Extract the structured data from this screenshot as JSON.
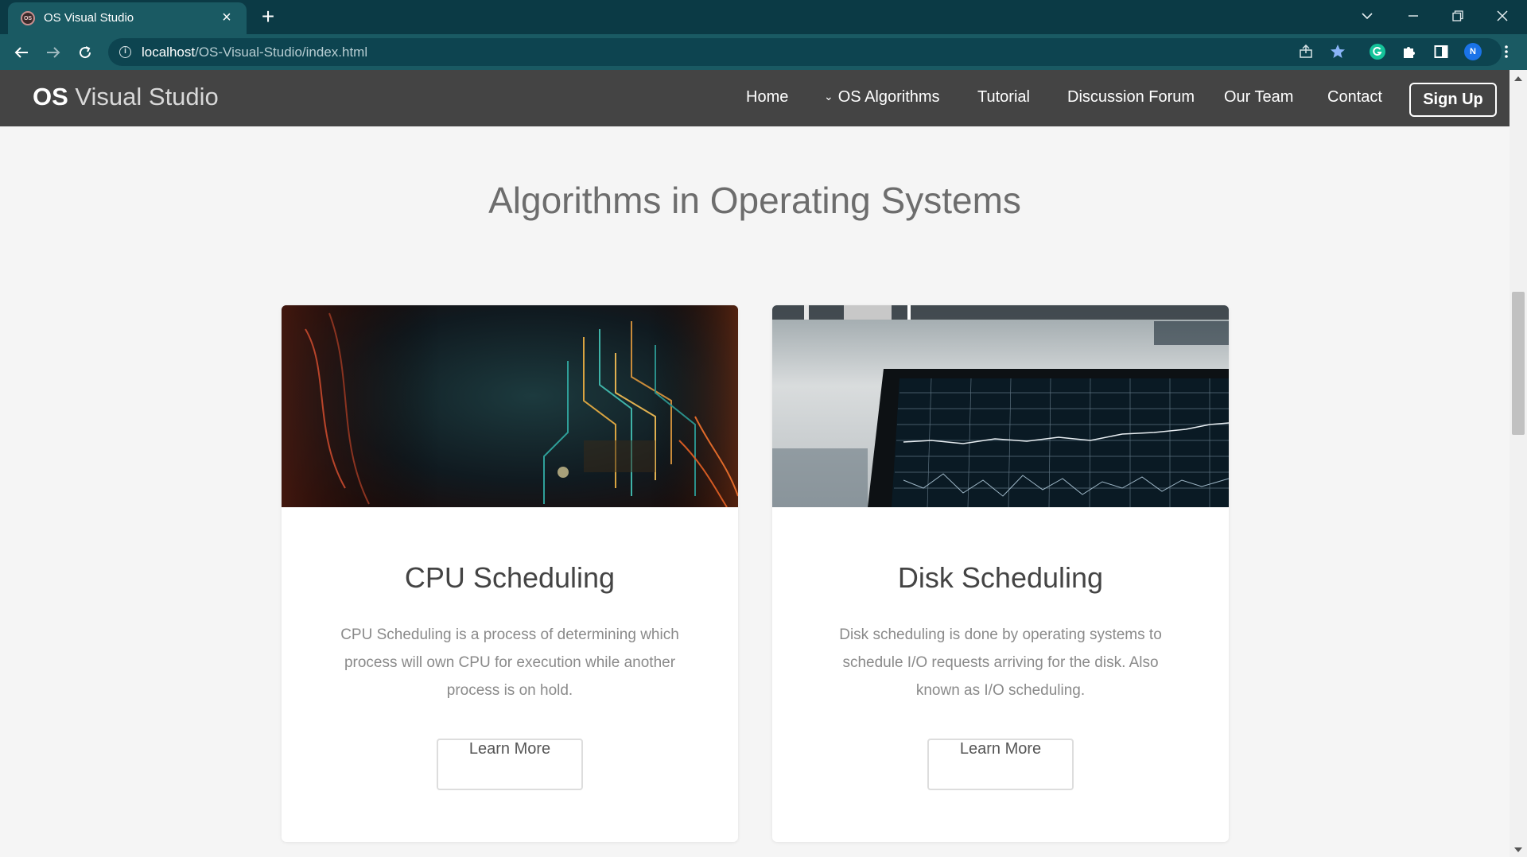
{
  "browser": {
    "tab": {
      "title": "OS Visual Studio",
      "favicon_icon": "os-logo-icon",
      "favicon_text": "OS"
    },
    "url": {
      "host": "localhost",
      "path": "/OS-Visual-Studio/index.html"
    },
    "profile_initial": "N",
    "colors": {
      "tabbar": "#0b3a45",
      "toolbar": "#1a5a63",
      "omnibox": "#0d4450"
    }
  },
  "site": {
    "brand_bold": "OS",
    "brand_rest": " Visual Studio",
    "nav": [
      {
        "label": "Home"
      },
      {
        "label": "OS Algorithms",
        "has_dropdown": true
      },
      {
        "label": "Tutorial"
      },
      {
        "label": "Discussion Forum"
      },
      {
        "label": "Our Team"
      },
      {
        "label": "Contact"
      }
    ],
    "signup_label": "Sign Up",
    "colors": {
      "navbar": "#444444",
      "page_bg": "#f5f5f5"
    }
  },
  "section": {
    "title": "Algorithms in Operating Systems"
  },
  "cards": [
    {
      "title": "CPU Scheduling",
      "text": "CPU Scheduling is a process of determining which process will own CPU for execution while another process is on hold.",
      "button": "Learn More",
      "image_alt": "circuit-board-image"
    },
    {
      "title": "Disk Scheduling",
      "text": "Disk scheduling is done by operating systems to schedule I/O requests arriving for the disk. Also known as I/O scheduling.",
      "button": "Learn More",
      "image_alt": "monitor-chart-image"
    }
  ]
}
